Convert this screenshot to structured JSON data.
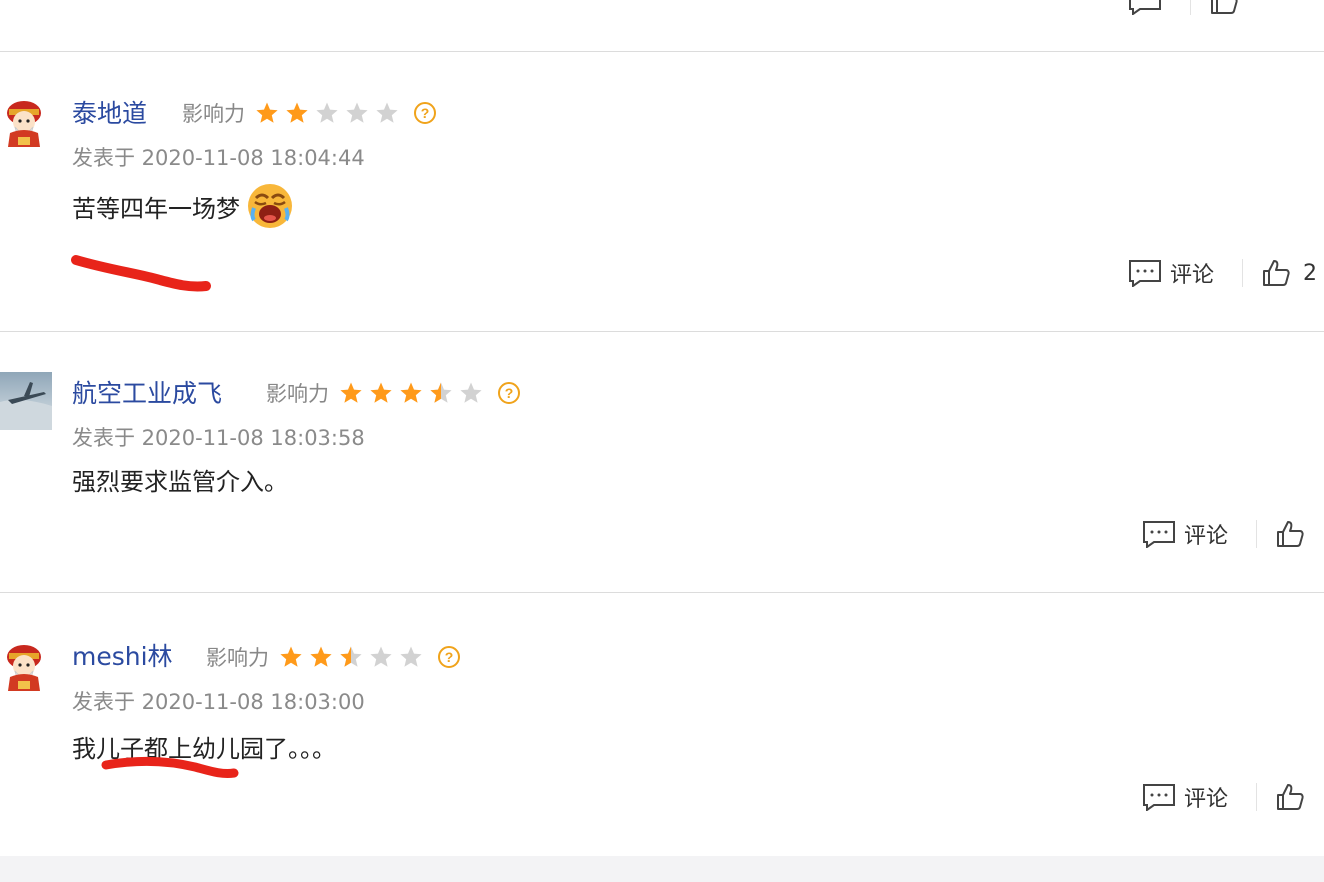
{
  "colors": {
    "username": "#2b4aa0",
    "star_on": "#ff9a1a",
    "star_off": "#d2d2d2",
    "annotation_red": "#e8241a",
    "divider": "#dcdcdc"
  },
  "labels": {
    "influence": "影响力",
    "comment": "评论"
  },
  "icons": {
    "help": "question-circle-icon",
    "comment": "comment-bubble-icon",
    "like": "thumbs-up-icon"
  },
  "comments": [
    {
      "avatar": "caishen-avatar",
      "username": "泰地道",
      "stars": 2,
      "date": "发表于 2020-11-08 18:04:44",
      "text": "苦等四年一场梦",
      "emoji": "crying-face-emoji",
      "likes": "2"
    },
    {
      "avatar": "airplane-sky-avatar",
      "username": "航空工业成飞",
      "stars": 3.5,
      "date": "发表于 2020-11-08 18:03:58",
      "text": "强烈要求监管介入。"
    },
    {
      "avatar": "caishen-avatar",
      "username": "meshi林",
      "stars": 2.5,
      "date": "发表于 2020-11-08 18:03:00",
      "text": "我儿子都上幼儿园了。。。"
    }
  ]
}
